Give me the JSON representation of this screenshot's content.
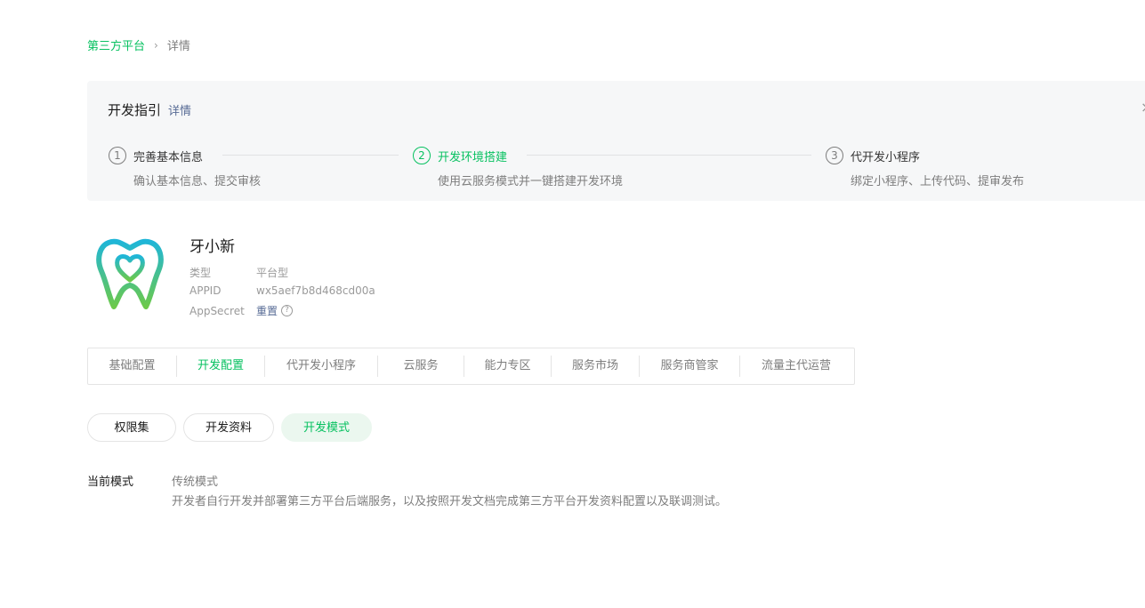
{
  "breadcrumb": {
    "parent": "第三方平台",
    "separator": "›",
    "current": "详情"
  },
  "guide": {
    "title": "开发指引",
    "detail_link": "详情",
    "close_icon": "×",
    "steps": [
      {
        "num": "1",
        "name": "完善基本信息",
        "desc": "确认基本信息、提交审核",
        "active": false
      },
      {
        "num": "2",
        "name": "开发环境搭建",
        "desc": "使用云服务模式并一键搭建开发环境",
        "active": true
      },
      {
        "num": "3",
        "name": "代开发小程序",
        "desc": "绑定小程序、上传代码、提审发布",
        "active": false
      }
    ]
  },
  "app": {
    "name": "牙小新",
    "logo_icon": "tooth-heart-logo",
    "rows": [
      {
        "label": "类型",
        "value": "平台型"
      },
      {
        "label": "APPID",
        "value": "wx5aef7b8d468cd00a"
      },
      {
        "label": "AppSecret",
        "value": "重置",
        "help": "?"
      }
    ]
  },
  "tabs": [
    {
      "label": "基础配置",
      "active": false
    },
    {
      "label": "开发配置",
      "active": true
    },
    {
      "label": "代开发小程序",
      "active": false
    },
    {
      "label": "云服务",
      "active": false
    },
    {
      "label": "能力专区",
      "active": false
    },
    {
      "label": "服务市场",
      "active": false
    },
    {
      "label": "服务商管家",
      "active": false
    },
    {
      "label": "流量主代运营",
      "active": false
    }
  ],
  "subtabs": [
    {
      "label": "权限集",
      "active": false
    },
    {
      "label": "开发资料",
      "active": false
    },
    {
      "label": "开发模式",
      "active": true
    }
  ],
  "mode": {
    "label": "当前模式",
    "name": "传统模式",
    "desc": "开发者自行开发并部署第三方平台后端服务，以及按照开发文档完成第三方平台开发资料配置以及联调测试。"
  },
  "colors": {
    "accent": "#07c160",
    "link": "#576b95",
    "panel_bg": "#f6f7f8",
    "subtab_active_bg": "#ebf7ef"
  }
}
